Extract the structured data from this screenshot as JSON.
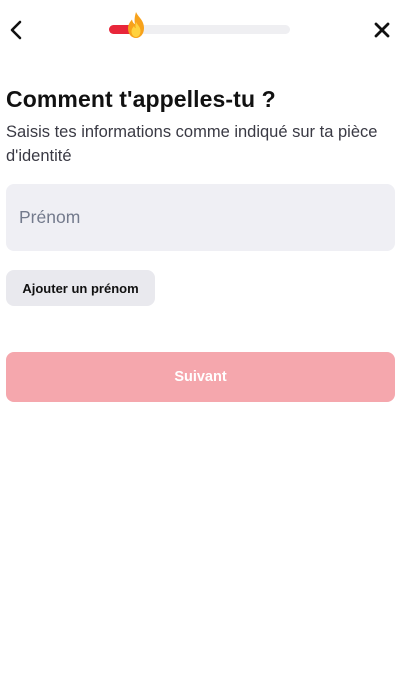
{
  "header": {
    "back_icon": "chevron-left-icon",
    "close_icon": "close-icon",
    "progress": {
      "fraction": 0.15,
      "fill_color": "#e8263a",
      "track_color": "#efeff2",
      "marker_icon": "flame-icon"
    }
  },
  "main": {
    "title": "Comment t'appelles-tu ?",
    "subtitle": "Saisis tes informations comme indiqué sur ta pièce d'identité",
    "first_name_field": {
      "placeholder": "Prénom",
      "value": ""
    },
    "add_first_name_label": "Ajouter un prénom",
    "next_label": "Suivant",
    "next_color": "#f5a7ad"
  }
}
